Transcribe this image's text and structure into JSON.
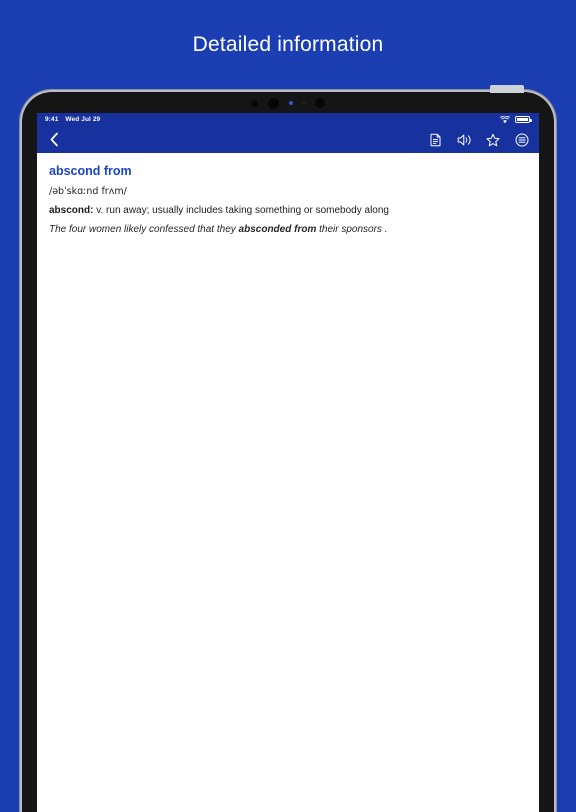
{
  "promo": {
    "title": "Detailed information"
  },
  "theme": {
    "background_blue": "#1c3eb3",
    "bar_blue": "#17329e",
    "headword_blue": "#1a44c8",
    "screen_white": "#ffffff",
    "bezel_black": "#151515",
    "bezel_edge": "#b9bcc2"
  },
  "status_bar": {
    "time": "9:41",
    "date": "Wed Jul 29",
    "wifi_icon": "wifi-icon",
    "battery_icon": "battery-icon"
  },
  "nav_bar": {
    "back_icon": "chevron-left-icon",
    "actions": [
      {
        "icon": "note-document-icon",
        "label": "Notes"
      },
      {
        "icon": "speaker-sound-icon",
        "label": "Pronounce"
      },
      {
        "icon": "star-favorite-icon",
        "label": "Favorite"
      },
      {
        "icon": "list-menu-circle-icon",
        "label": "Menu"
      }
    ]
  },
  "entry": {
    "headword": "abscond from",
    "ipa": "/əbˈskɑːnd frʌm/",
    "definition_word": "abscond:",
    "definition_text": " v. run away; usually includes taking something or somebody along",
    "example_before": "The four women likely confessed that they ",
    "example_highlight": "absconded from",
    "example_after": " their sponsors ."
  }
}
